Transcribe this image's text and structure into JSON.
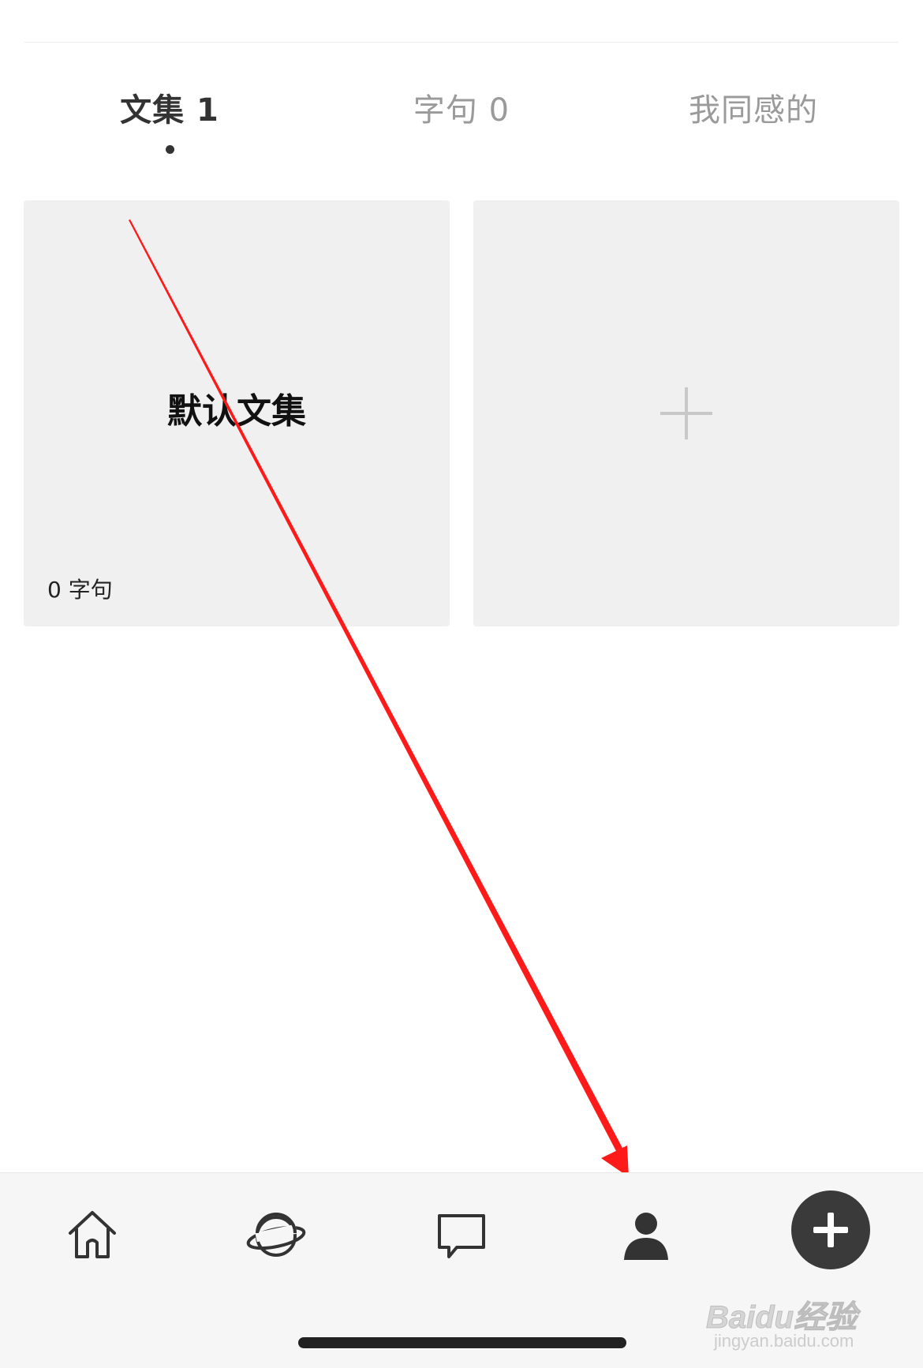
{
  "tabs": [
    {
      "label": "文集 1",
      "active": true
    },
    {
      "label": "字句 0",
      "active": false
    },
    {
      "label": "我同感的",
      "active": false
    }
  ],
  "collections": {
    "default_card": {
      "title": "默认文集",
      "count": "0 字句"
    }
  },
  "bottom_nav": {
    "items": [
      {
        "icon": "home-icon"
      },
      {
        "icon": "planet-icon"
      },
      {
        "icon": "chat-bubble-icon"
      },
      {
        "icon": "profile-icon"
      },
      {
        "icon": "plus-icon"
      }
    ]
  },
  "watermark": {
    "logo": "Baidu经验",
    "url": "jingyan.baidu.com"
  },
  "colors": {
    "annotation_arrow": "#ff1a1a",
    "fab": "#3a3a3a",
    "card_bg": "#f0f0f0",
    "tabbar_bg": "#f6f6f6"
  }
}
